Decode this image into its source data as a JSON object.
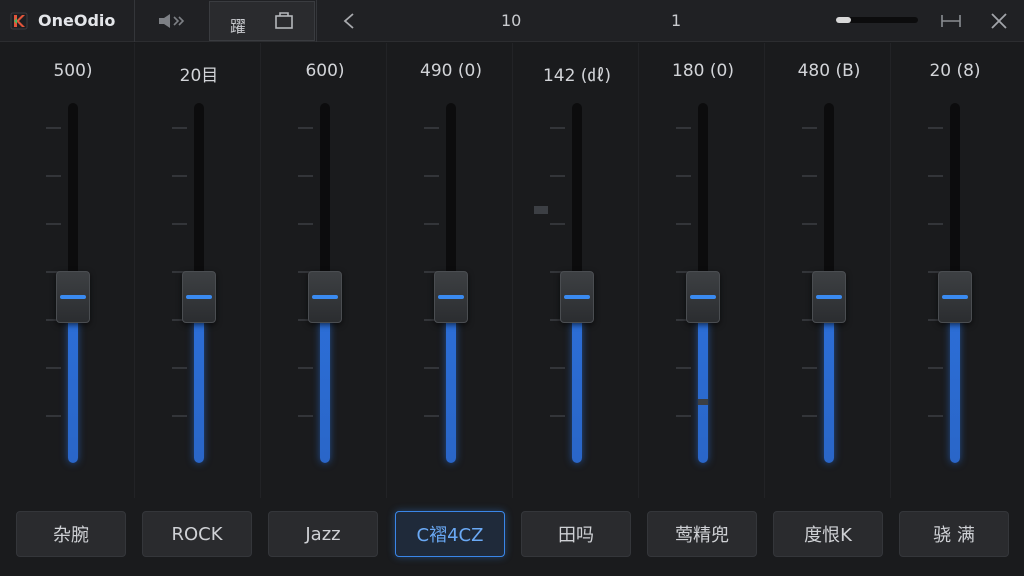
{
  "titlebar": {
    "app_title": "OneOdio",
    "tab_label": "躍",
    "value_left": "10",
    "value_right": "1",
    "volume_level": 0.18
  },
  "bands": [
    {
      "value": "500)",
      "level": 0.46
    },
    {
      "value": "20目",
      "level": 0.46
    },
    {
      "value": "600)",
      "level": 0.46
    },
    {
      "value": "490 (0)",
      "level": 0.46
    },
    {
      "value": "142 (㎗)",
      "level": 0.46
    },
    {
      "value": "180 (0)",
      "level": 0.46
    },
    {
      "value": "480 (B)",
      "level": 0.46
    },
    {
      "value": "20 (8)",
      "level": 0.46
    }
  ],
  "presets": [
    {
      "label": "杂腕",
      "active": false
    },
    {
      "label": "ROCK",
      "active": false
    },
    {
      "label": "Jazz",
      "active": false
    },
    {
      "label": "C褶4CZ",
      "active": true
    },
    {
      "label": "田吗",
      "active": false
    },
    {
      "label": "莺精兜",
      "active": false
    },
    {
      "label": "度恨K",
      "active": false
    },
    {
      "label": "骁 满",
      "active": false
    }
  ],
  "colors": {
    "accent": "#3a8af0",
    "background": "#1a1b1d",
    "panel": "#2a2b2e"
  },
  "icons": [
    "logo-icon",
    "speaker-icon",
    "window-icon",
    "back-arrow-icon",
    "expand-icon",
    "close-icon"
  ]
}
